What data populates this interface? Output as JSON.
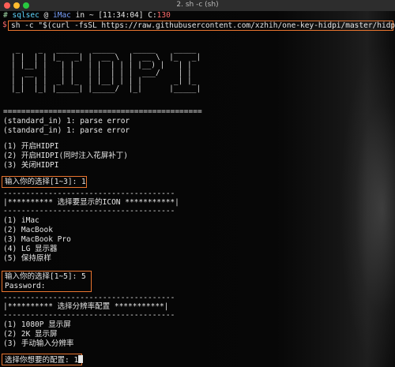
{
  "window": {
    "title": "2. sh -c (sh)"
  },
  "prompt": {
    "hash": "#",
    "user": "sqlsec",
    "at": "@",
    "host": "iMac",
    "in": "in",
    "dir": "~",
    "time": "[11:34:04]",
    "code_label": "C:",
    "code": "130",
    "dollar": "$",
    "command": "sh -c \"$(curl -fsSL https://raw.githubusercontent.com/xzhih/one-key-hidpi/master/hidpi-zh.sh)\""
  },
  "ascii_art": [
    " _    _   _____   _____    _____    _____",
    "| |  | | |_   _| |  __ \\  |  __ \\  |_   _|",
    "| |__| |   | |   | |  | | | |__) |   | |",
    "|  __  |   | |   | |  | | |  ___/    | |",
    "| |  | |  _| |_  | |__| | | |       _| |_",
    "|_|  |_| |_____| |_____/  |_|      |_____|"
  ],
  "lines": {
    "separator1": "============================================",
    "err1": "(standard_in) 1: parse error",
    "err2": "(standard_in) 1: parse error",
    "opt1": "(1) 开启HIDPI",
    "opt2": "(2) 开启HIDPI(同时注入花屏补丁)",
    "opt3": "(3) 关闭HIDPI",
    "input1": "输入你的选择[1~3]: 1",
    "dash1": "--------------------------------------",
    "icon_header": "|********** 选择要显示的ICON ***********|",
    "dash2": "--------------------------------------",
    "icon1": "(1) iMac",
    "icon2": "(2) MacBook",
    "icon3": "(3) MacBook Pro",
    "icon4": "(4) LG 显示器",
    "icon5": "(5) 保持原样",
    "input2": "输入你的选择[1~5]: 5",
    "password": "Password:",
    "dash3": "--------------------------------------",
    "res_header": "|********** 选择分辨率配置 ***********|",
    "dash4": "--------------------------------------",
    "res1": "(1) 1080P 显示屏",
    "res2": "(2) 2K 显示屏",
    "res3": "(3) 手动输入分辨率",
    "input3": "选择你想要的配置: 1"
  },
  "colors": {
    "highlight_box": "#e8742e",
    "background": "#0b0b0b",
    "text": "#e6e6e6"
  }
}
